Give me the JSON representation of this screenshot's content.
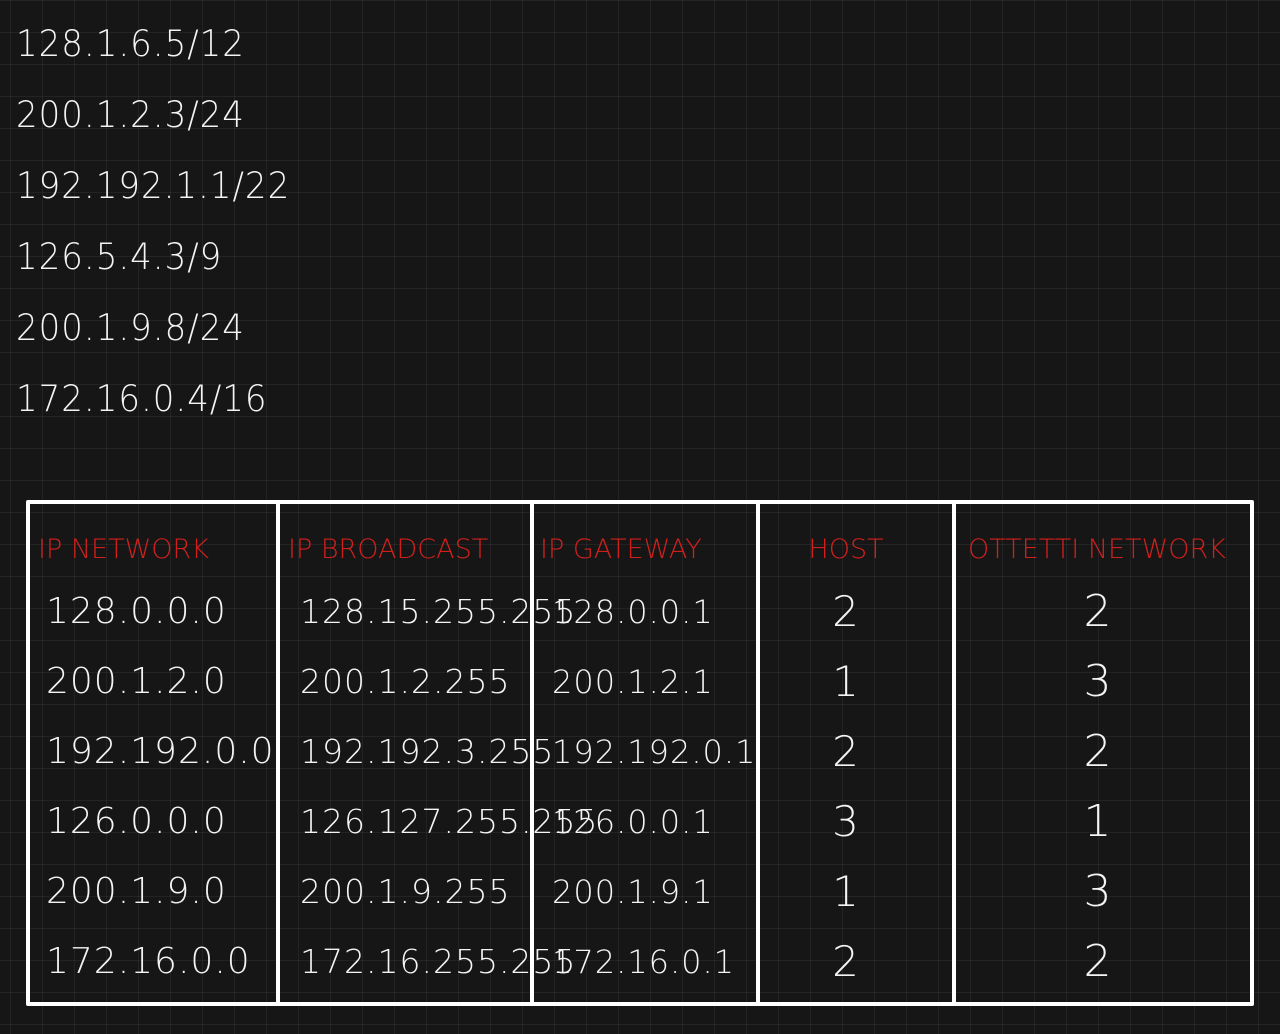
{
  "addresses": [
    "128.1.6.5/12",
    "200.1.2.3/24",
    "192.192.1.1/22",
    "126.5.4.3/9",
    "200.1.9.8/24",
    "172.16.0.4/16"
  ],
  "table": {
    "headers": {
      "network": "IP NETWORK",
      "broadcast": "IP BROADCAST",
      "gateway": "IP GATEWAY",
      "host": "HOST",
      "subnets": "OTTETTI NETWORK"
    },
    "rows": [
      {
        "network": "128.0.0.0",
        "broadcast": "128.15.255.255",
        "gateway": "128.0.0.1",
        "host": "2",
        "subnets": "2"
      },
      {
        "network": "200.1.2.0",
        "broadcast": "200.1.2.255",
        "gateway": "200.1.2.1",
        "host": "1",
        "subnets": "3"
      },
      {
        "network": "192.192.0.0",
        "broadcast": "192.192.3.255",
        "gateway": "192.192.0.1",
        "host": "2",
        "subnets": "2"
      },
      {
        "network": "126.0.0.0",
        "broadcast": "126.127.255.255",
        "gateway": "126.0.0.1",
        "host": "3",
        "subnets": "1"
      },
      {
        "network": "200.1.9.0",
        "broadcast": "200.1.9.255",
        "gateway": "200.1.9.1",
        "host": "1",
        "subnets": "3"
      },
      {
        "network": "172.16.0.0",
        "broadcast": "172.16.255.255",
        "gateway": "172.16.0.1",
        "host": "2",
        "subnets": "2"
      }
    ]
  },
  "colors": {
    "background": "#161616",
    "ink": "#f4f4f4",
    "header_ink": "#d1201c",
    "table_border": "#ffffff"
  }
}
